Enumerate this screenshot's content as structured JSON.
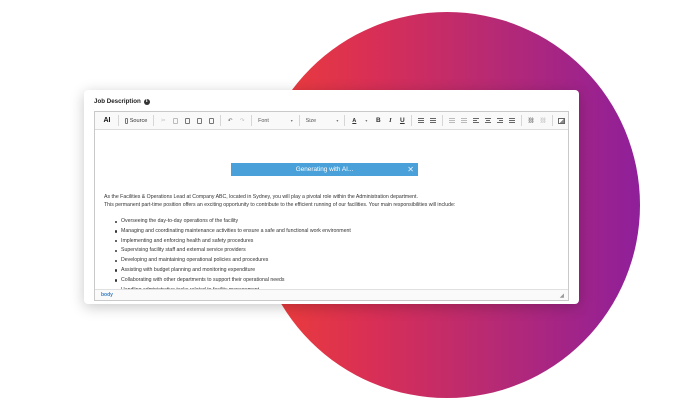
{
  "colors": {
    "circle_start": "#ef3f35",
    "circle_end": "#8f1f9a",
    "generating_bar": "#4aa0d8"
  },
  "field": {
    "label": "Job Description",
    "info_icon": "info-circle-icon"
  },
  "toolbar": {
    "ai_label": "AI",
    "source_label": "Source",
    "font_select": "Font",
    "size_select": "Size",
    "bold": "B",
    "italic": "I",
    "underline": "U",
    "text_color": "A"
  },
  "generating": {
    "label": "Generating with AI...",
    "close": "✕"
  },
  "content": {
    "intro_line1": "As the Facilities & Operations Lead at Company ABC, located in Sydney, you will play a pivotal role within the Administration department.",
    "intro_line2": "This permanent part-time position offers an exciting  opportunity to contribute to the efficient running of our facilities. Your main responsibilities will include:",
    "duties": [
      "Overseeing the day-to-day operations of the facility",
      "Managing and coordinating maintenance activities to ensure a safe and functional work environment",
      "Implementing and enforcing health and safety procedures",
      "Supervising facility staff and external service providers",
      "Developing and maintaining operational policies and procedures",
      "Assisting with budget planning and monitoring expenditure",
      "Collaborating with other departments to support their operational needs",
      "Handling administrative tasks related to facility management"
    ]
  },
  "status": {
    "element_path": "body"
  }
}
